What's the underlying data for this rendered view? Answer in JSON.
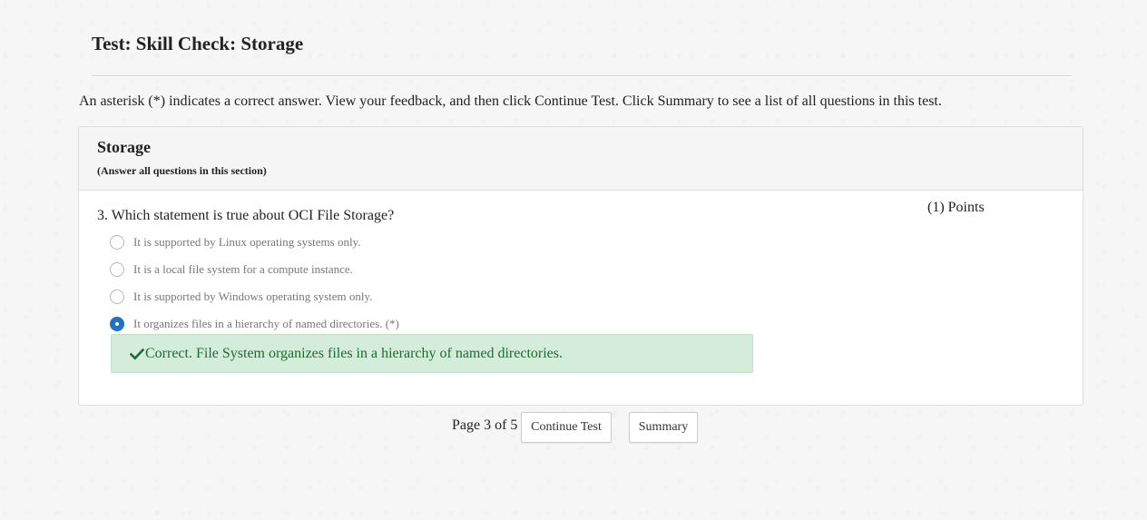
{
  "page": {
    "title": "Test: Skill Check: Storage",
    "instructions": "An asterisk (*) indicates a correct answer. View your feedback, and then click Continue Test. Click Summary to see a list of all questions in this test."
  },
  "section": {
    "title": "Storage",
    "subtitle": "(Answer all questions in this section)"
  },
  "question": {
    "text": "3. Which statement is true about OCI File Storage?",
    "points": "(1) Points",
    "options": [
      {
        "label": "It is supported by Linux operating systems only.",
        "selected": false
      },
      {
        "label": "It is a local file system for a compute instance.",
        "selected": false
      },
      {
        "label": "It is supported by Windows operating system only.",
        "selected": false
      },
      {
        "label": "It organizes files in a hierarchy of named directories. (*)",
        "selected": true
      }
    ],
    "feedback": "Correct. File System organizes files in a hierarchy of named directories."
  },
  "pager": {
    "text": "Page 3 of 5",
    "continue_label": "Continue Test",
    "summary_label": "Summary"
  },
  "colors": {
    "selected_radio": "#1f72c6",
    "feedback_bg": "#d4edda",
    "feedback_text": "#1e6a30"
  },
  "icons": {
    "feedback": "check-icon",
    "option_selected": "radio-checked-icon",
    "option_unselected": "radio-unchecked-icon"
  }
}
